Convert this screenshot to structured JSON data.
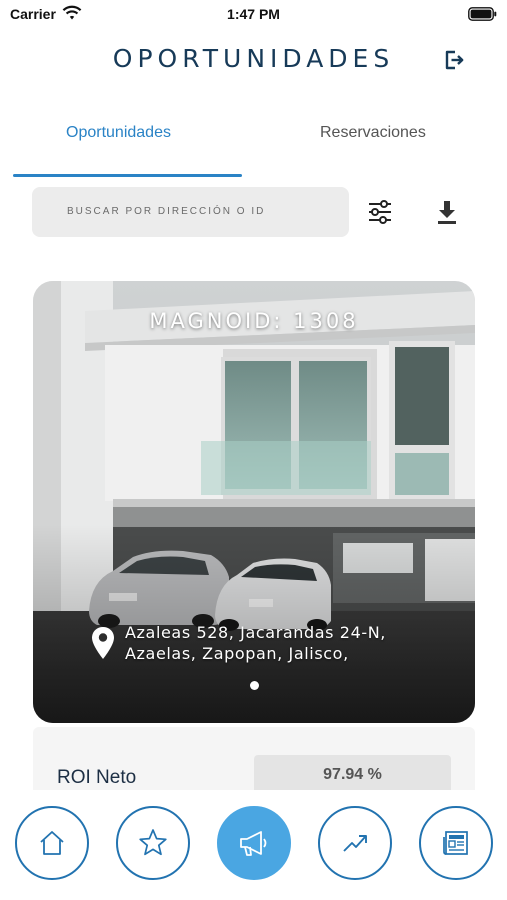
{
  "status_bar": {
    "carrier": "Carrier",
    "time": "1:47 PM"
  },
  "header": {
    "title": "OPORTUNIDADES",
    "logout_icon": "logout-icon"
  },
  "tabs": [
    {
      "label": "Oportunidades",
      "active": true
    },
    {
      "label": "Reservaciones",
      "active": false
    }
  ],
  "search": {
    "placeholder": "BUSCAR POR DIRECCIÓN O ID",
    "value": ""
  },
  "toolbar": {
    "filter_icon": "sliders-icon",
    "download_icon": "download-icon"
  },
  "card": {
    "id_label": "MAGNOID: 1308",
    "address": "Azaleas 528, Jacarandas 24-N, Azaelas, Zapopan, Jalisco,",
    "image_pages": 1,
    "current_page": 1
  },
  "info": {
    "roi_label": "ROI Neto",
    "roi_value": "97.94 %"
  },
  "bottom_nav": [
    {
      "icon": "home-icon",
      "active": false
    },
    {
      "icon": "star-icon",
      "active": false
    },
    {
      "icon": "megaphone-icon",
      "active": true
    },
    {
      "icon": "trending-up-icon",
      "active": false
    },
    {
      "icon": "newspaper-icon",
      "active": false
    }
  ],
  "colors": {
    "accent": "#2a83c6",
    "title": "#173a58",
    "nav_active": "#4aa6e2",
    "nav_border": "#2273b0"
  }
}
